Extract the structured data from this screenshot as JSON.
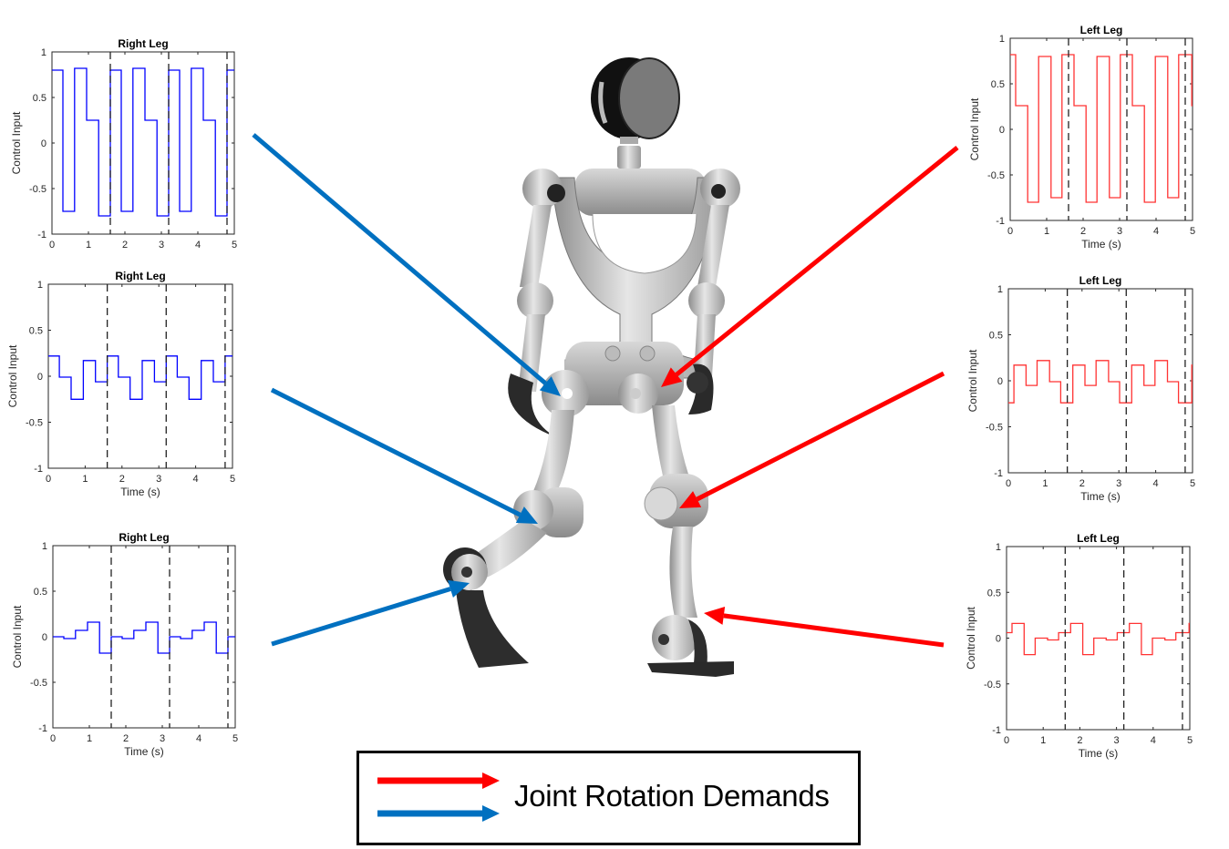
{
  "legend": {
    "label": "Joint Rotation Demands",
    "arrows": [
      {
        "name": "left-leg-arrow",
        "color": "#ff0000"
      },
      {
        "name": "right-leg-arrow",
        "color": "#0070c0"
      }
    ]
  },
  "colors": {
    "right_leg": "#0000ff",
    "left_leg": "#ff3333",
    "right_arrow": "#0070c0",
    "left_arrow": "#ff0000",
    "period_marker": "#222222"
  },
  "chart_data": [
    {
      "id": "right-hip",
      "type": "line",
      "step": true,
      "title": "Right Leg",
      "xlabel": "",
      "ylabel": "Control Input",
      "xlim": [
        0,
        5
      ],
      "ylim": [
        -1,
        1
      ],
      "xticks": [
        "0",
        "1",
        "2",
        "3",
        "4",
        "5"
      ],
      "yticks": [
        "-1",
        "-0.5",
        "0",
        "0.5",
        "1"
      ],
      "period_markers": [
        1.6,
        3.2,
        4.8
      ],
      "series": [
        {
          "name": "Right Leg",
          "color": "#0000ff",
          "x": [
            0,
            0.3,
            0.3,
            0.62,
            0.62,
            0.95,
            0.95,
            1.28,
            1.28,
            1.6,
            1.6,
            1.9,
            1.9,
            2.22,
            2.22,
            2.55,
            2.55,
            2.88,
            2.88,
            3.2,
            3.2,
            3.5,
            3.5,
            3.82,
            3.82,
            4.15,
            4.15,
            4.48,
            4.48,
            4.8,
            4.8,
            5.0
          ],
          "y": [
            0.8,
            0.8,
            -0.75,
            -0.75,
            0.82,
            0.82,
            0.25,
            0.25,
            -0.8,
            -0.8,
            0.8,
            0.8,
            -0.75,
            -0.75,
            0.82,
            0.82,
            0.25,
            0.25,
            -0.8,
            -0.8,
            0.8,
            0.8,
            -0.75,
            -0.75,
            0.82,
            0.82,
            0.25,
            0.25,
            -0.8,
            -0.8,
            0.8,
            0.8
          ]
        }
      ]
    },
    {
      "id": "right-knee",
      "type": "line",
      "step": true,
      "title": "Right Leg",
      "xlabel": "Time (s)",
      "ylabel": "Control Input",
      "xlim": [
        0,
        5
      ],
      "ylim": [
        -1,
        1
      ],
      "xticks": [
        "0",
        "1",
        "2",
        "3",
        "4",
        "5"
      ],
      "yticks": [
        "-1",
        "-0.5",
        "0",
        "0.5",
        "1"
      ],
      "period_markers": [
        1.6,
        3.2,
        4.8
      ],
      "series": [
        {
          "name": "Right Leg",
          "color": "#0000ff",
          "x": [
            0,
            0.3,
            0.3,
            0.62,
            0.62,
            0.95,
            0.95,
            1.28,
            1.28,
            1.6,
            1.6,
            1.9,
            1.9,
            2.22,
            2.22,
            2.55,
            2.55,
            2.88,
            2.88,
            3.2,
            3.2,
            3.5,
            3.5,
            3.82,
            3.82,
            4.15,
            4.15,
            4.48,
            4.48,
            4.8,
            4.8,
            5.0
          ],
          "y": [
            0.22,
            0.22,
            -0.01,
            -0.01,
            -0.25,
            -0.25,
            0.17,
            0.17,
            -0.06,
            -0.06,
            0.22,
            0.22,
            -0.01,
            -0.01,
            -0.25,
            -0.25,
            0.17,
            0.17,
            -0.06,
            -0.06,
            0.22,
            0.22,
            -0.01,
            -0.01,
            -0.25,
            -0.25,
            0.17,
            0.17,
            -0.06,
            -0.06,
            0.22,
            0.22
          ]
        }
      ]
    },
    {
      "id": "right-ankle",
      "type": "line",
      "step": true,
      "title": "Right Leg",
      "xlabel": "Time (s)",
      "ylabel": "Control Input",
      "xlim": [
        0,
        5
      ],
      "ylim": [
        -1,
        1
      ],
      "xticks": [
        "0",
        "1",
        "2",
        "3",
        "4",
        "5"
      ],
      "yticks": [
        "-1",
        "-0.5",
        "0",
        "0.5",
        "1"
      ],
      "period_markers": [
        1.6,
        3.2,
        4.8
      ],
      "series": [
        {
          "name": "Right Leg",
          "color": "#0000ff",
          "x": [
            0,
            0.3,
            0.3,
            0.62,
            0.62,
            0.95,
            0.95,
            1.28,
            1.28,
            1.6,
            1.6,
            1.9,
            1.9,
            2.22,
            2.22,
            2.55,
            2.55,
            2.88,
            2.88,
            3.2,
            3.2,
            3.5,
            3.5,
            3.82,
            3.82,
            4.15,
            4.15,
            4.48,
            4.48,
            4.8,
            4.8,
            5.0
          ],
          "y": [
            0.0,
            0.0,
            -0.02,
            -0.02,
            0.07,
            0.07,
            0.16,
            0.16,
            -0.18,
            -0.18,
            0.0,
            0.0,
            -0.02,
            -0.02,
            0.07,
            0.07,
            0.16,
            0.16,
            -0.18,
            -0.18,
            0.0,
            0.0,
            -0.02,
            -0.02,
            0.07,
            0.07,
            0.16,
            0.16,
            -0.18,
            -0.18,
            0.0,
            0.0
          ]
        }
      ]
    },
    {
      "id": "left-hip",
      "type": "line",
      "step": true,
      "title": "Left Leg",
      "xlabel": "Time (s)",
      "ylabel": "Control Input",
      "xlim": [
        0,
        5
      ],
      "ylim": [
        -1,
        1
      ],
      "xticks": [
        "0",
        "1",
        "2",
        "3",
        "4",
        "5"
      ],
      "yticks": [
        "-1",
        "-0.5",
        "0",
        "0.5",
        "1"
      ],
      "period_markers": [
        1.6,
        3.2,
        4.8
      ],
      "series": [
        {
          "name": "Left Leg",
          "color": "#ff3333",
          "x": [
            0,
            0.15,
            0.15,
            0.48,
            0.48,
            0.78,
            0.78,
            1.12,
            1.12,
            1.42,
            1.42,
            1.75,
            1.75,
            2.08,
            2.08,
            2.38,
            2.38,
            2.72,
            2.72,
            3.02,
            3.02,
            3.35,
            3.35,
            3.68,
            3.68,
            3.98,
            3.98,
            4.32,
            4.32,
            4.62,
            4.62,
            4.98,
            4.98,
            5.0
          ],
          "y": [
            0.82,
            0.82,
            0.26,
            0.26,
            -0.8,
            -0.8,
            0.8,
            0.8,
            -0.75,
            -0.75,
            0.82,
            0.82,
            0.26,
            0.26,
            -0.8,
            -0.8,
            0.8,
            0.8,
            -0.75,
            -0.75,
            0.82,
            0.82,
            0.26,
            0.26,
            -0.8,
            -0.8,
            0.8,
            0.8,
            -0.75,
            -0.75,
            0.82,
            0.82,
            0.26,
            0.26
          ]
        }
      ]
    },
    {
      "id": "left-knee",
      "type": "line",
      "step": true,
      "title": "Left Leg",
      "xlabel": "Time (s)",
      "ylabel": "Control Input",
      "xlim": [
        0,
        5
      ],
      "ylim": [
        -1,
        1
      ],
      "xticks": [
        "0",
        "1",
        "2",
        "3",
        "4",
        "5"
      ],
      "yticks": [
        "-1",
        "-0.5",
        "0",
        "0.5",
        "1"
      ],
      "period_markers": [
        1.6,
        3.2,
        4.8
      ],
      "series": [
        {
          "name": "Left Leg",
          "color": "#ff3333",
          "x": [
            0,
            0.15,
            0.15,
            0.48,
            0.48,
            0.78,
            0.78,
            1.12,
            1.12,
            1.42,
            1.42,
            1.75,
            1.75,
            2.08,
            2.08,
            2.38,
            2.38,
            2.72,
            2.72,
            3.02,
            3.02,
            3.35,
            3.35,
            3.68,
            3.68,
            3.98,
            3.98,
            4.32,
            4.32,
            4.62,
            4.62,
            4.98,
            4.98,
            5.0
          ],
          "y": [
            -0.24,
            -0.24,
            0.17,
            0.17,
            -0.05,
            -0.05,
            0.22,
            0.22,
            -0.01,
            -0.01,
            -0.24,
            -0.24,
            0.17,
            0.17,
            -0.05,
            -0.05,
            0.22,
            0.22,
            -0.01,
            -0.01,
            -0.24,
            -0.24,
            0.17,
            0.17,
            -0.05,
            -0.05,
            0.22,
            0.22,
            -0.01,
            -0.01,
            -0.24,
            -0.24,
            0.17,
            0.17
          ]
        }
      ]
    },
    {
      "id": "left-ankle",
      "type": "line",
      "step": true,
      "title": "Left Leg",
      "xlabel": "Time (s)",
      "ylabel": "Control Input",
      "xlim": [
        0,
        5
      ],
      "ylim": [
        -1,
        1
      ],
      "xticks": [
        "0",
        "1",
        "2",
        "3",
        "4",
        "5"
      ],
      "yticks": [
        "-1",
        "-0.5",
        "0",
        "0.5",
        "1"
      ],
      "period_markers": [
        1.6,
        3.2,
        4.8
      ],
      "series": [
        {
          "name": "Left Leg",
          "color": "#ff3333",
          "x": [
            0,
            0.15,
            0.15,
            0.48,
            0.48,
            0.78,
            0.78,
            1.12,
            1.12,
            1.42,
            1.42,
            1.75,
            1.75,
            2.08,
            2.08,
            2.38,
            2.38,
            2.72,
            2.72,
            3.02,
            3.02,
            3.35,
            3.35,
            3.68,
            3.68,
            3.98,
            3.98,
            4.32,
            4.32,
            4.62,
            4.62,
            4.98,
            4.98,
            5.0
          ],
          "y": [
            0.06,
            0.06,
            0.16,
            0.16,
            -0.18,
            -0.18,
            0.0,
            0.0,
            -0.02,
            -0.02,
            0.06,
            0.06,
            0.16,
            0.16,
            -0.18,
            -0.18,
            0.0,
            0.0,
            -0.02,
            -0.02,
            0.06,
            0.06,
            0.16,
            0.16,
            -0.18,
            -0.18,
            0.0,
            0.0,
            -0.02,
            -0.02,
            0.06,
            0.06,
            0.16,
            0.16
          ]
        }
      ]
    }
  ]
}
